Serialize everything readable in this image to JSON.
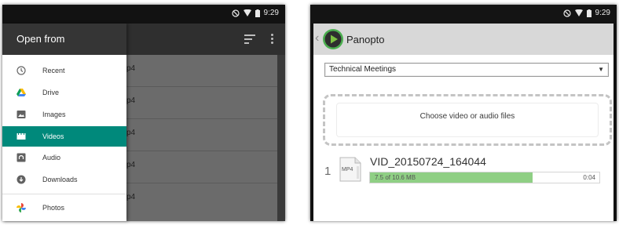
{
  "left": {
    "status": {
      "time": "9:29",
      "icons": [
        "do-not-disturb-icon",
        "wifi-icon",
        "battery-icon"
      ]
    },
    "drawer": {
      "title": "Open from",
      "items": [
        {
          "label": "Recent",
          "icon": "clock-icon",
          "active": false
        },
        {
          "label": "Drive",
          "icon": "drive-icon",
          "active": false
        },
        {
          "label": "Images",
          "icon": "image-icon",
          "active": false
        },
        {
          "label": "Videos",
          "icon": "video-icon",
          "active": true
        },
        {
          "label": "Audio",
          "icon": "audio-icon",
          "active": false
        },
        {
          "label": "Downloads",
          "icon": "download-icon",
          "active": false
        },
        {
          "label": "Photos",
          "icon": "photos-icon",
          "active": false
        }
      ],
      "accent_color": "#00897b"
    },
    "toolbar": {
      "icons": [
        "sort-icon",
        "more-vert-icon"
      ]
    },
    "files": [
      {
        "suffix": "p4"
      },
      {
        "suffix": "p4"
      },
      {
        "suffix": "p4"
      },
      {
        "suffix": "p4"
      },
      {
        "suffix": "p4"
      }
    ]
  },
  "right": {
    "status": {
      "time": "9:29"
    },
    "app": {
      "title": "Panopto",
      "logo": "panopto-play-logo"
    },
    "folder_select": {
      "value": "Technical Meetings"
    },
    "dropzone": {
      "label": "Choose video or audio files"
    },
    "upload": {
      "index": "1",
      "file_type": "MP4",
      "file_name": "VID_20150724_164044",
      "progress_text": "7.5 of 10.6 MB",
      "progress_fraction": 0.71,
      "elapsed": "0:04",
      "bar_color": "#8fcf84"
    }
  }
}
